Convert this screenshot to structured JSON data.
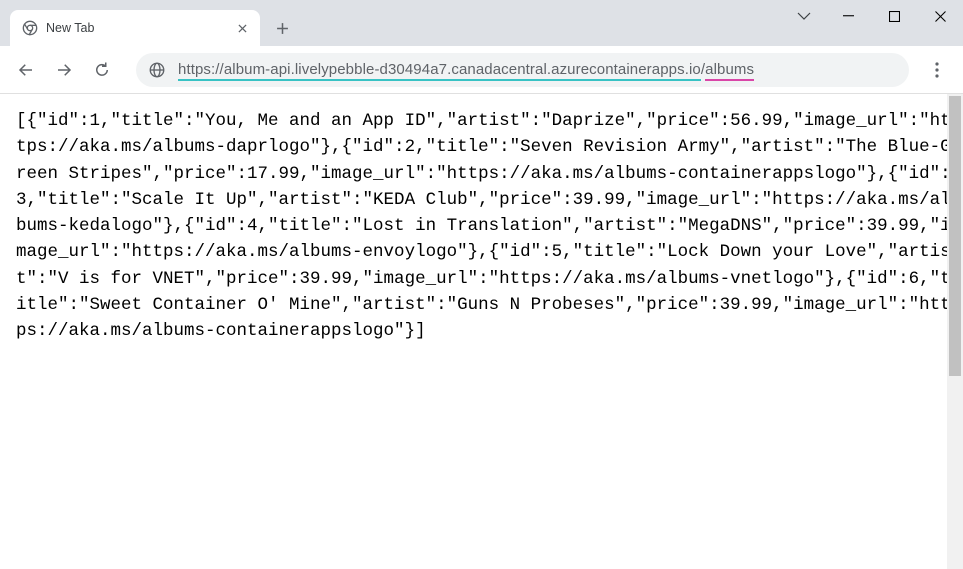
{
  "window": {
    "tab_title": "New Tab"
  },
  "address_bar": {
    "protocol_host": "https://album-api.livelypebble-d30494a7.canadacentral.azurecontainerapps.io",
    "path_sep": "/",
    "path": "albums"
  },
  "response_body": "[{\"id\":1,\"title\":\"You, Me and an App ID\",\"artist\":\"Daprize\",\"price\":56.99,\"image_url\":\"https://aka.ms/albums-daprlogo\"},{\"id\":2,\"title\":\"Seven Revision Army\",\"artist\":\"The Blue-Green Stripes\",\"price\":17.99,\"image_url\":\"https://aka.ms/albums-containerappslogo\"},{\"id\":3,\"title\":\"Scale It Up\",\"artist\":\"KEDA Club\",\"price\":39.99,\"image_url\":\"https://aka.ms/albums-kedalogo\"},{\"id\":4,\"title\":\"Lost in Translation\",\"artist\":\"MegaDNS\",\"price\":39.99,\"image_url\":\"https://aka.ms/albums-envoylogo\"},{\"id\":5,\"title\":\"Lock Down your Love\",\"artist\":\"V is for VNET\",\"price\":39.99,\"image_url\":\"https://aka.ms/albums-vnetlogo\"},{\"id\":6,\"title\":\"Sweet Container O' Mine\",\"artist\":\"Guns N Probeses\",\"price\":39.99,\"image_url\":\"https://aka.ms/albums-containerappslogo\"}]"
}
